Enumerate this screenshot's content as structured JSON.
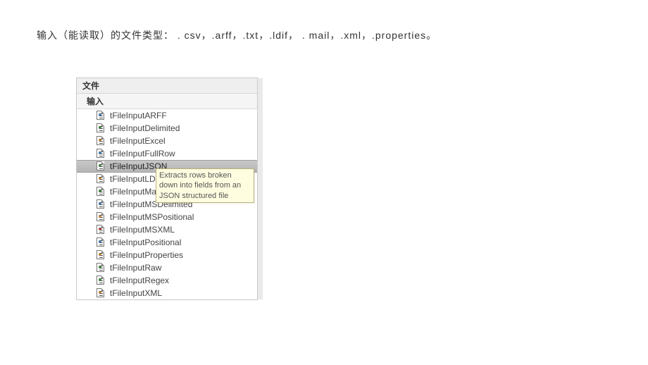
{
  "description": "输入（能读取）的文件类型： . csv，.arff，.txt，.ldif， . mail，.xml，.properties。",
  "tree": {
    "header": "文件",
    "subheader": "输入",
    "items": [
      {
        "label": "tFileInputARFF",
        "selected": false
      },
      {
        "label": "tFileInputDelimited",
        "selected": false
      },
      {
        "label": "tFileInputExcel",
        "selected": false
      },
      {
        "label": "tFileInputFullRow",
        "selected": false
      },
      {
        "label": "tFileInputJSON",
        "selected": true
      },
      {
        "label": "tFileInputLDIF",
        "selected": false
      },
      {
        "label": "tFileInputMail",
        "selected": false
      },
      {
        "label": "tFileInputMSDelimited",
        "selected": false
      },
      {
        "label": "tFileInputMSPositional",
        "selected": false
      },
      {
        "label": "tFileInputMSXML",
        "selected": false
      },
      {
        "label": "tFileInputPositional",
        "selected": false
      },
      {
        "label": "tFileInputProperties",
        "selected": false
      },
      {
        "label": "tFileInputRaw",
        "selected": false
      },
      {
        "label": "tFileInputRegex",
        "selected": false
      },
      {
        "label": "tFileInputXML",
        "selected": false
      }
    ]
  },
  "tooltip": "Extracts rows broken down into fields from an JSON structured file"
}
